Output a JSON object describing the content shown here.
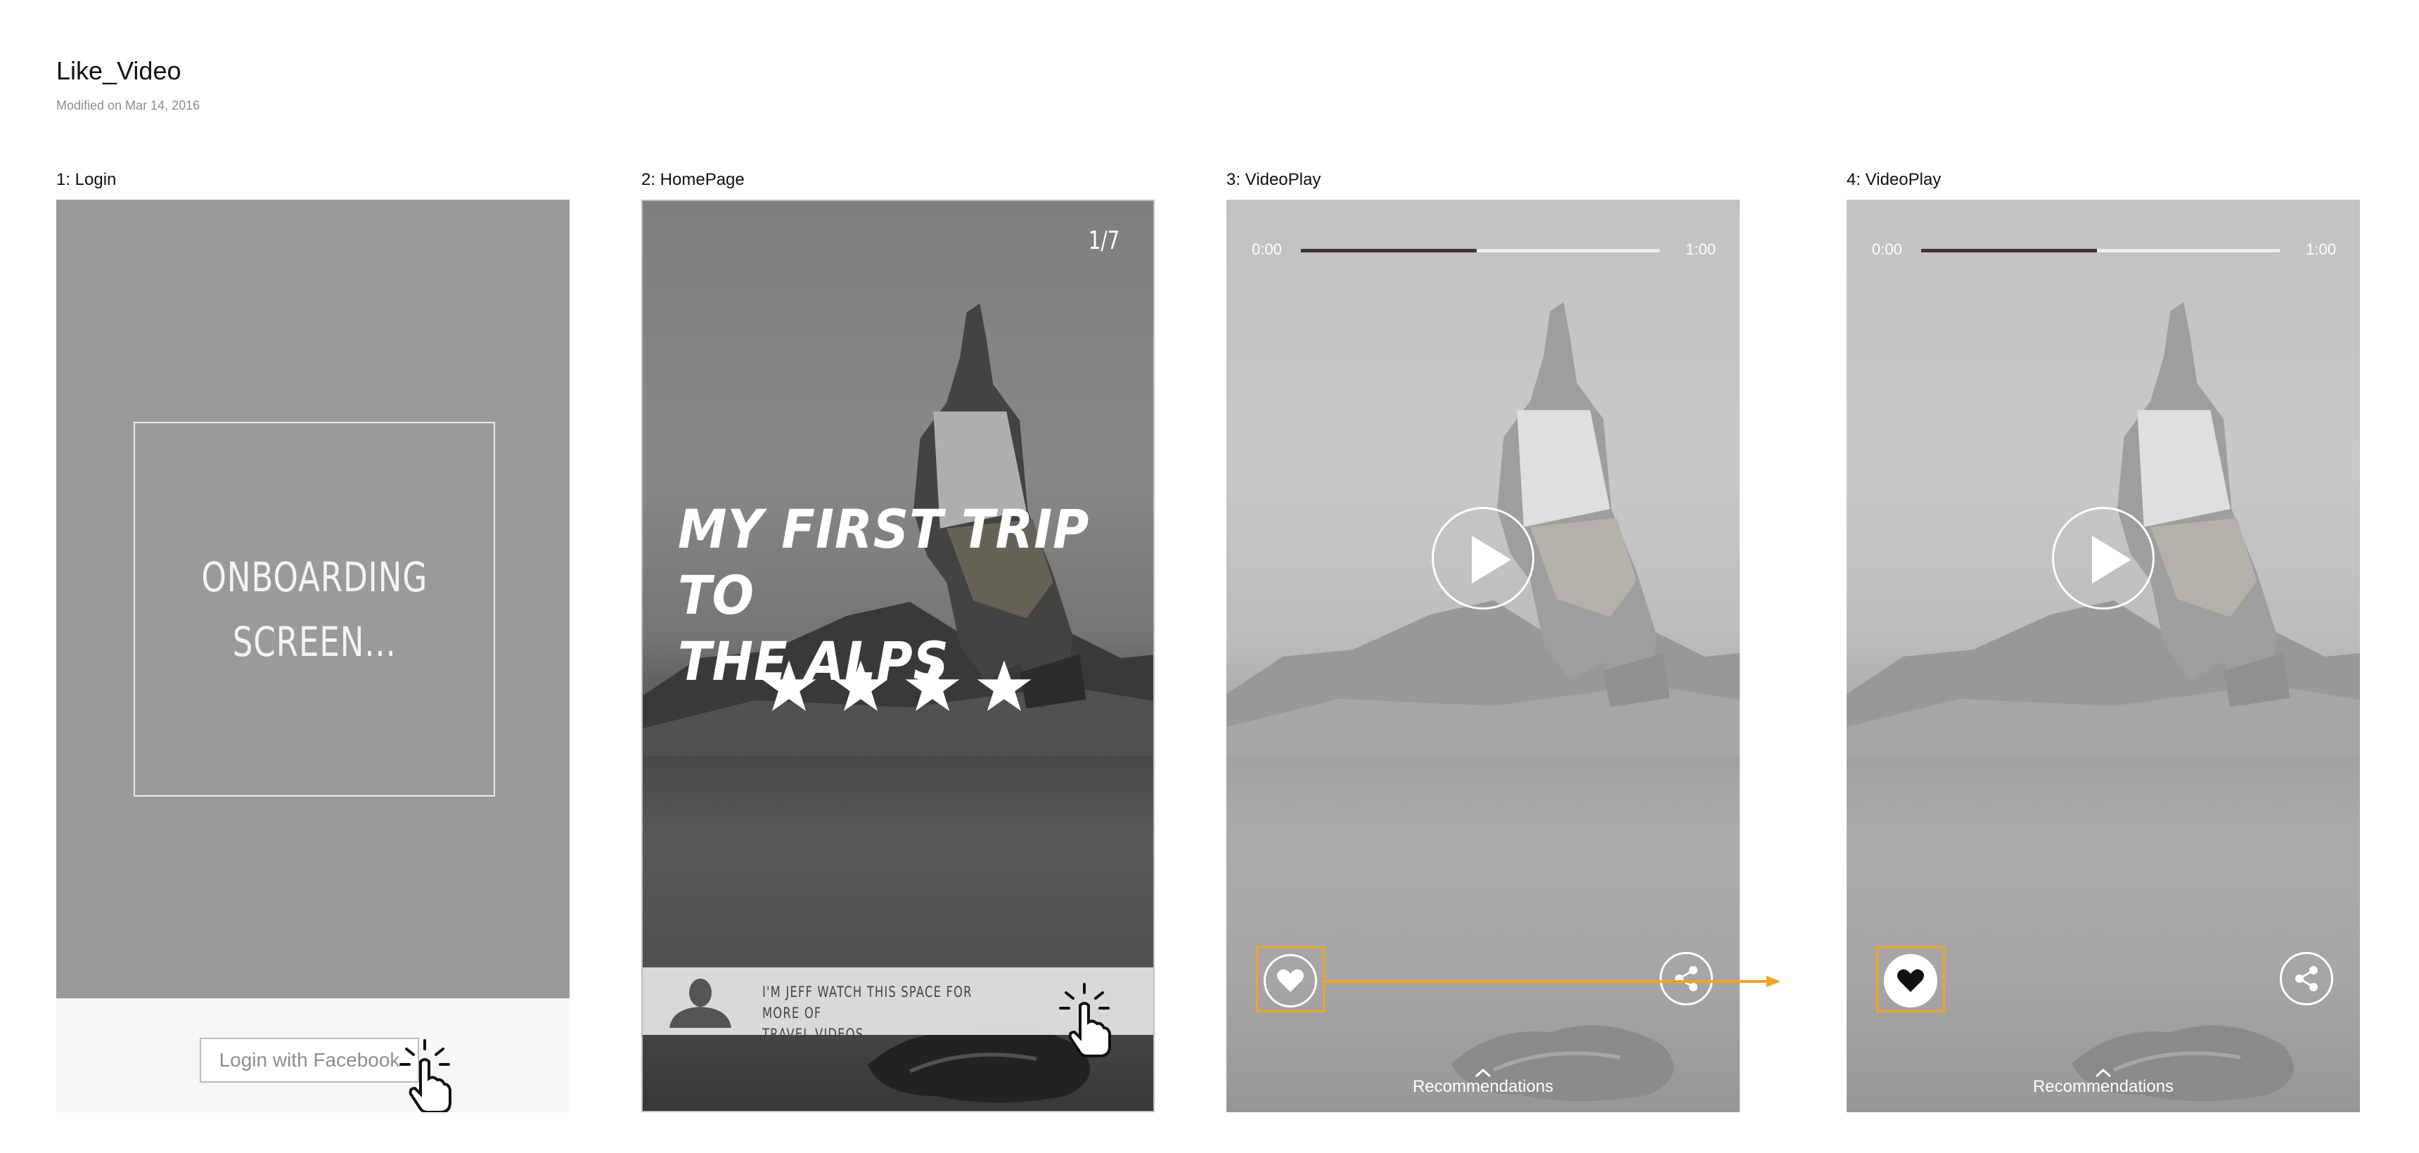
{
  "page": {
    "title": "Like_Video",
    "modified": "Modified on Mar 14, 2016"
  },
  "screens": [
    {
      "label": "1: Login",
      "onboarding_text": "ONBOARDING\nSCREEN...",
      "login_button": "Login with Facebook"
    },
    {
      "label": "2: HomePage",
      "page_count": "1/7",
      "hero_title": "MY FIRST TRIP TO\nTHE ALPS",
      "rating_stars": 4,
      "banner_text": "I'M JEFF WATCH THIS SPACE FOR MORE OF\nTRAVEL VIDEOS"
    },
    {
      "label": "3: VideoPlay",
      "time_start": "0:00",
      "time_end": "1:00",
      "progress_fraction": 0.49,
      "liked": false,
      "recommendations": "Recommendations"
    },
    {
      "label": "4: VideoPlay",
      "time_start": "0:00",
      "time_end": "1:00",
      "progress_fraction": 0.49,
      "liked": true,
      "recommendations": "Recommendations"
    }
  ],
  "colors": {
    "highlight": "#f0a524",
    "progress_fill": "#3e3636",
    "progress_track": "#eeeeee"
  },
  "icons": [
    "tap-cursor-icon",
    "star-icon",
    "person-silhouette-icon",
    "play-icon",
    "heart-icon",
    "share-icon",
    "chevron-up-icon"
  ]
}
